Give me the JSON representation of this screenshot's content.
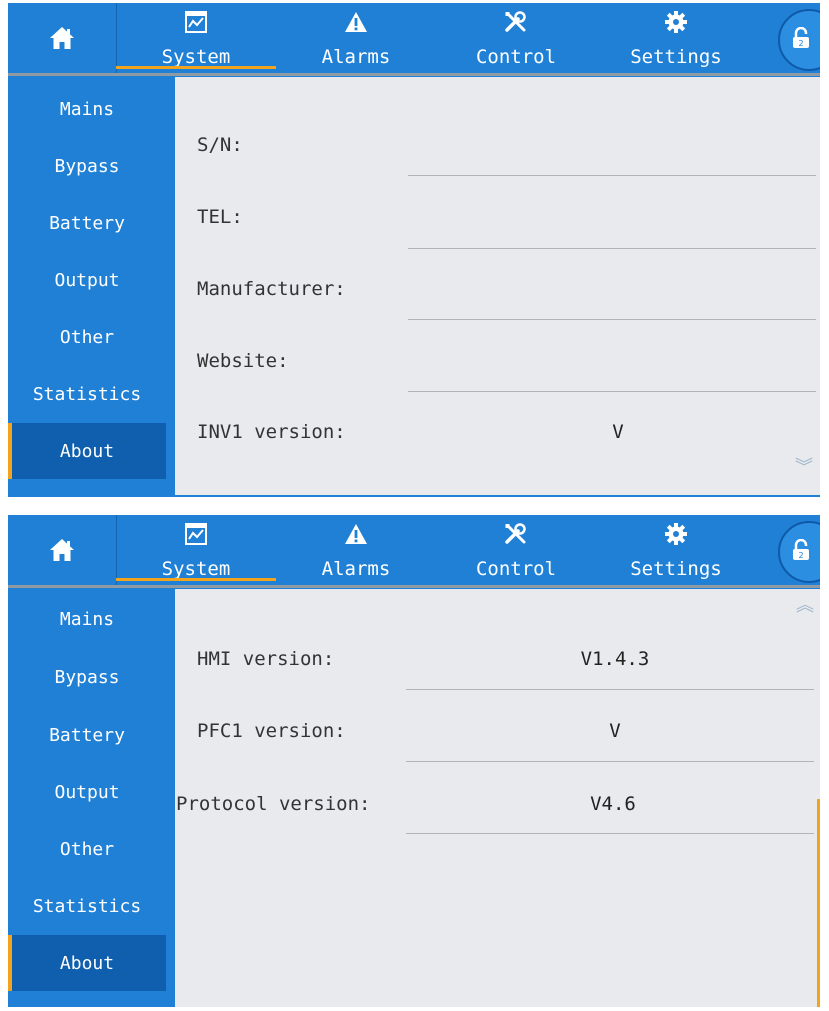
{
  "nav": {
    "tabs": [
      {
        "label": "System",
        "icon": "chart-icon"
      },
      {
        "label": "Alarms",
        "icon": "warning-icon"
      },
      {
        "label": "Control",
        "icon": "tools-icon"
      },
      {
        "label": "Settings",
        "icon": "gear-icon"
      }
    ],
    "active_tab": "System",
    "lock_badge": "2"
  },
  "sidebar": {
    "items": [
      "Mains",
      "Bypass",
      "Battery",
      "Output",
      "Other",
      "Statistics",
      "About"
    ],
    "active": "About"
  },
  "screen1": {
    "rows": [
      {
        "label": "S/N:",
        "value": ""
      },
      {
        "label": "TEL:",
        "value": ""
      },
      {
        "label": "Manufacturer:",
        "value": ""
      },
      {
        "label": "Website:",
        "value": ""
      },
      {
        "label": "INV1 version:",
        "value": "V"
      }
    ]
  },
  "screen2": {
    "rows": [
      {
        "label": "HMI version:",
        "value": "V1.4.3"
      },
      {
        "label": "PFC1 version:",
        "value": "V"
      },
      {
        "label": "Protocol version:",
        "value": "V4.6"
      }
    ]
  },
  "colors": {
    "primary": "#1f80d6",
    "active": "#0f5fae",
    "accent": "#f2a51c",
    "content_bg": "#e8eaee"
  }
}
